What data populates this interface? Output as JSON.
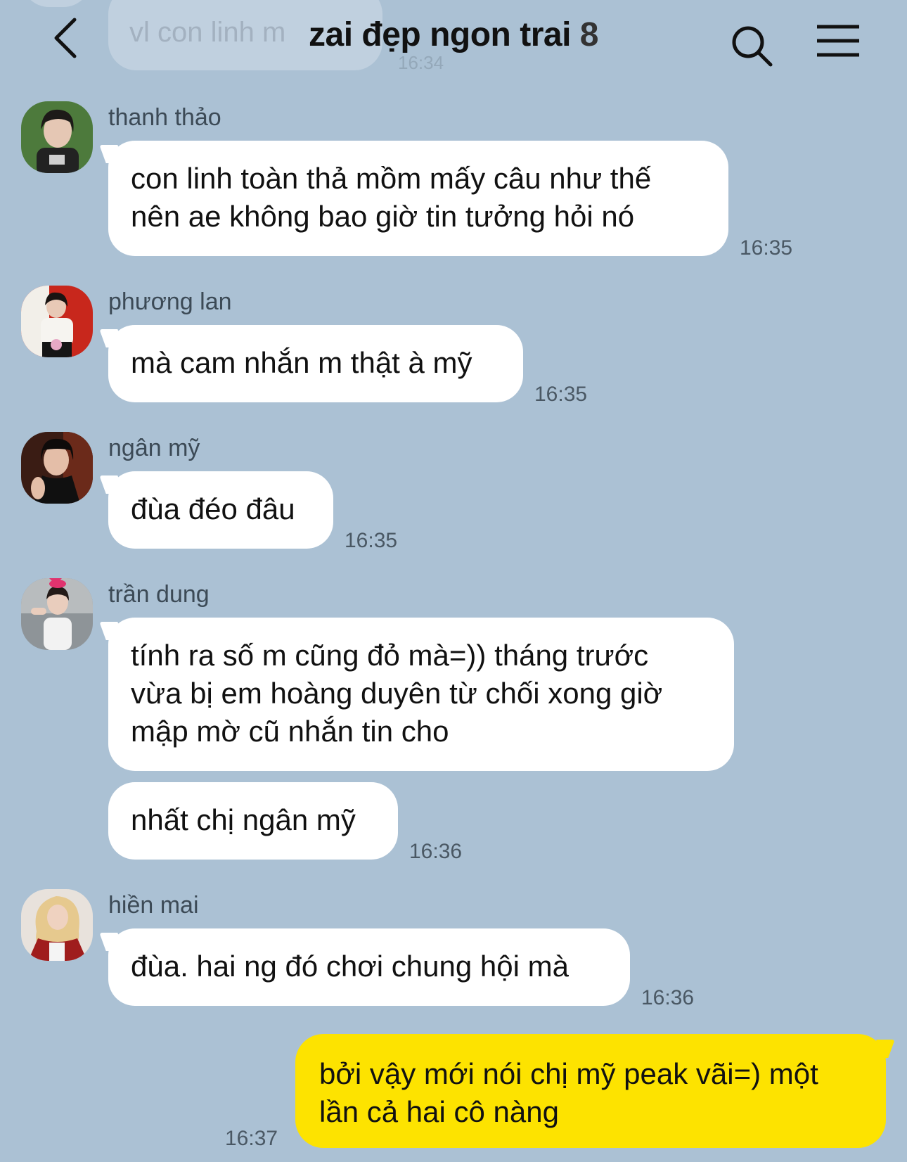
{
  "header": {
    "title": "zai đẹp ngon trai",
    "member_count": "8",
    "back_icon": "chevron-left-icon",
    "search_icon": "search-icon",
    "menu_icon": "hamburger-menu-icon"
  },
  "previous": {
    "text": "vl con linh m",
    "time": "16:34"
  },
  "messages": [
    {
      "sender": "thanh thảo",
      "text_lines": [
        "con linh toàn thả mồm mấy câu như thế",
        "nên ae không bao giờ tin tưởng hỏi nó"
      ],
      "time": "16:35"
    },
    {
      "sender": "phương lan",
      "text_lines": [
        "mà cam nhắn m thật à mỹ"
      ],
      "time": "16:35"
    },
    {
      "sender": "ngân mỹ",
      "text_lines": [
        "đùa đéo đâu"
      ],
      "time": "16:35"
    },
    {
      "sender": "trần dung",
      "text_lines": [
        "tính ra số m cũng đỏ mà=)) tháng trước",
        "vừa bị em hoàng duyên từ chối xong giờ",
        "mập mờ cũ nhắn tin cho"
      ]
    },
    {
      "sender": "",
      "text_lines": [
        "nhất chị ngân mỹ"
      ],
      "time": "16:36"
    },
    {
      "sender": "hiền mai",
      "text_lines": [
        "đùa. hai ng đó chơi chung hội mà"
      ],
      "time": "16:36"
    }
  ],
  "my_message": {
    "text_lines": [
      "bởi vậy mới nói chị mỹ peak vãi=) một",
      "lần cả hai cô nàng"
    ],
    "time": "16:37"
  },
  "colors": {
    "background": "#abc1d4",
    "incoming_bubble": "#ffffff",
    "outgoing_bubble": "#fde300"
  }
}
